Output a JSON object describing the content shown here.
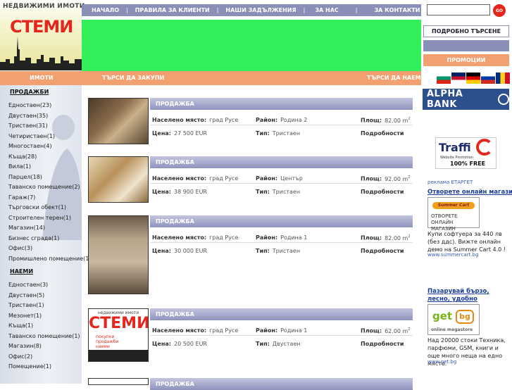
{
  "header": {
    "site_tag": "НЕДВИЖИМИ ИМОТИ",
    "logo": "СТЕМИ"
  },
  "nav": [
    "НАЧАЛО",
    "ПРАВИЛА ЗА КЛИЕНТИ",
    "НАШИ ЗАДЪЛЖЕНИЯ",
    "ЗА НАС",
    "ЗА КОНТАКТИ"
  ],
  "search": {
    "go": "GO",
    "placeholder": ""
  },
  "side_buttons": {
    "advanced": "ПОДРОБНО ТЪРСЕНЕ",
    "promo": "ПРОМОЦИИ"
  },
  "sections": {
    "imoti": "ИМОТИ",
    "buy": "ТЪРСИ ДА ЗАКУПИ",
    "rent": "ТЪРСИ ДА НАЕМЕ"
  },
  "flags": [
    {
      "name": "bg-flag-icon",
      "colors": [
        "#ffffff",
        "#00966e",
        "#d62612"
      ]
    },
    {
      "name": "uk-flag-icon",
      "colors": [
        "#012169",
        "#c8102e",
        "#ffffff"
      ]
    },
    {
      "name": "de-flag-icon",
      "colors": [
        "#000000",
        "#dd0000",
        "#ffce00"
      ]
    },
    {
      "name": "ru-flag-icon",
      "colors": [
        "#ffffff",
        "#0039a6",
        "#d52b1e"
      ]
    },
    {
      "name": "ro-flag-icon",
      "colors": [
        "#002b7f",
        "#fcd116",
        "#ce1126"
      ]
    }
  ],
  "menu": {
    "sale_title": "ПРОДАЖБИ",
    "sale": [
      "Едностаен(23)",
      "Двустаен(35)",
      "Тристаен(31)",
      "Четиристаен(1)",
      "Многостаен(4)",
      "Къща(28)",
      "Вила(1)",
      "Парцел(18)",
      "Таванско помещение(2)",
      "Гараж(7)",
      "Търговски обект(1)",
      "Строителен терен(1)",
      "Магазин(14)",
      "Бизнес сграда(1)",
      "Офис(3)",
      "Промишлено помещение(1)"
    ],
    "rent_title": "НАЕМИ",
    "rent": [
      "Едностаен(3)",
      "Двустаен(5)",
      "Тристаен(1)",
      "Мезонет(1)",
      "Къща(1)",
      "Таванско помещение(1)",
      "Магазин(8)",
      "Офис(2)",
      "Помещение(1)"
    ]
  },
  "labels": {
    "place": "Населено място:",
    "district": "Район:",
    "area": "Площ:",
    "price": "Цена:",
    "type": "Тип:",
    "details": "Подробности"
  },
  "listings": [
    {
      "header": "ПРОДАЖБА",
      "place": "град Русе",
      "district": "Родина 2",
      "area": "82.00 m",
      "area_sup": "2",
      "price": "27 500 EUR",
      "type": "Тристаен"
    },
    {
      "header": "ПРОДАЖБА",
      "place": "град Русе",
      "district": "Център",
      "area": "92.00 m",
      "area_sup": "2",
      "price": "38 900 EUR",
      "type": "Тристаен"
    },
    {
      "header": "ПРОДАЖБА",
      "place": "град Русе",
      "district": "Родина 1",
      "area": "82.00 m",
      "area_sup": "2",
      "price": "30 000 EUR",
      "type": "Тристаен"
    },
    {
      "header": "ПРОДАЖБА",
      "place": "град Русе",
      "district": "Родина 1",
      "area": "62.00 m",
      "area_sup": "2",
      "price": "20 500 EUR",
      "type": "Двустаен"
    },
    {
      "header": "ПРОДАЖБА"
    }
  ],
  "thumb4": {
    "tag": "недвижими имоти",
    "logo": "СТЕМИ",
    "lines": "покупки\nпродажби\nнаеми"
  },
  "right": {
    "alpha": "ALPHA BANK",
    "traffic_1": "Traffi",
    "traffic_2": "Website Promotion",
    "traffic_3": "100% FREE",
    "ad_label": "реклама ЕТАРГЕТ",
    "ad1_link": "Отворете онлайн магазин",
    "ad1_img_logo": "Summer Cart",
    "ad1_img_text": "ОТВОРЕТЕ ОНЛАЙН МАГАЗИН",
    "ad1_body": "Купи софтуера за 440 лв (без ддс). Вижте онлайн демо на Summer Cart 4.0 !",
    "ad1_url": "www.summercart.bg",
    "ad2_link": "Пазарувай бързо, лесно, удобно",
    "ad2_logo": "get",
    "ad2_logo2": "bg",
    "ad2_tag": "online megastore",
    "ad2_body": "Над 20000 стоки Техника, парфюми, GSM, книги и още много неща на едно място.",
    "ad2_url": "www.get.bg"
  },
  "colors": {
    "nav": "#8a8fb8",
    "orange": "#f3a070",
    "logo_red": "#e5261d",
    "banner": "#33f05a"
  }
}
